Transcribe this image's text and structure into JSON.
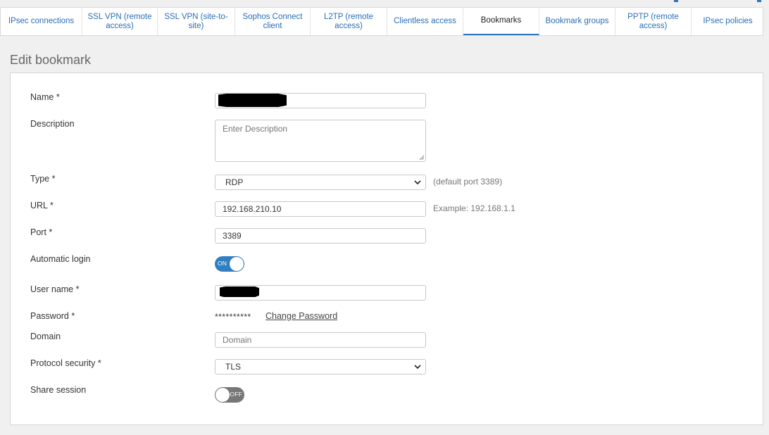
{
  "tabs": [
    {
      "label": "IPsec connections",
      "active": false
    },
    {
      "label": "SSL VPN (remote\naccess)",
      "active": false
    },
    {
      "label": "SSL VPN (site-to-\nsite)",
      "active": false
    },
    {
      "label": "Sophos Connect\nclient",
      "active": false
    },
    {
      "label": "L2TP (remote\naccess)",
      "active": false
    },
    {
      "label": "Clientless access",
      "active": false
    },
    {
      "label": "Bookmarks",
      "active": true
    },
    {
      "label": "Bookmark groups",
      "active": false
    },
    {
      "label": "PPTP (remote\naccess)",
      "active": false
    },
    {
      "label": "IPsec policies",
      "active": false
    }
  ],
  "page": {
    "title": "Edit bookmark"
  },
  "form": {
    "name": {
      "label": "Name *",
      "value": ""
    },
    "description": {
      "label": "Description",
      "placeholder": "Enter Description",
      "value": ""
    },
    "type": {
      "label": "Type *",
      "value": "RDP",
      "hint": "(default port 3389)"
    },
    "url": {
      "label": "URL *",
      "value": "192.168.210.10",
      "hint": "Example: 192.168.1.1"
    },
    "port": {
      "label": "Port *",
      "value": "3389"
    },
    "automatic_login": {
      "label": "Automatic login",
      "state": "ON"
    },
    "username": {
      "label": "User name *",
      "value": ""
    },
    "password": {
      "label": "Password *",
      "masked": "**********",
      "change_link": "Change Password"
    },
    "domain": {
      "label": "Domain",
      "placeholder": "Domain",
      "value": ""
    },
    "protocol_security": {
      "label": "Protocol security *",
      "value": "TLS"
    },
    "share_session": {
      "label": "Share session",
      "state": "OFF"
    }
  },
  "colors": {
    "accent": "#2f7fc1",
    "tab_text": "#2a6eb5",
    "toggle_off": "#777777"
  }
}
